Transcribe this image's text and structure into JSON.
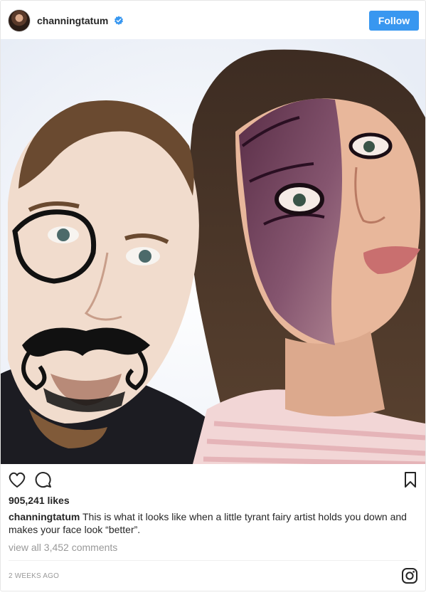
{
  "post": {
    "username": "channingtatum",
    "verified": true,
    "follow_label": "Follow",
    "likes": "905,241 likes",
    "caption_user": "channingtatum",
    "caption_text": " This is what it looks like when a little tyrant fairy artist holds you down and makes your face look “better”.",
    "view_comments": "view all 3,452 comments",
    "timestamp": "2 WEEKS AGO"
  },
  "colors": {
    "accent": "#3897f0",
    "text": "#262626",
    "muted": "#999999",
    "border": "#e6e6e6"
  },
  "icons": {
    "verified": "verified-badge-icon",
    "like": "heart-outline-icon",
    "comment": "comment-bubble-icon",
    "save": "bookmark-icon",
    "brand": "instagram-logo-icon"
  }
}
